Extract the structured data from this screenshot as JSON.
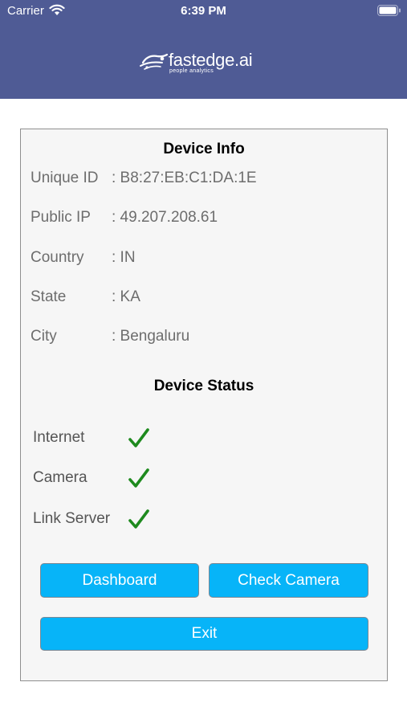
{
  "status_bar": {
    "carrier": "Carrier",
    "time": "6:39 PM"
  },
  "header": {
    "logo_text": "fastedge.ai",
    "logo_tagline": "people analytics"
  },
  "device_info": {
    "title": "Device Info",
    "rows": [
      {
        "label": "Unique ID",
        "value": ": B8:27:EB:C1:DA:1E"
      },
      {
        "label": "Public IP",
        "value": ": 49.207.208.61"
      },
      {
        "label": "Country",
        "value": ": IN"
      },
      {
        "label": "State",
        "value": ": KA"
      },
      {
        "label": "City",
        "value": ": Bengaluru"
      }
    ]
  },
  "device_status": {
    "title": "Device Status",
    "items": [
      {
        "label": "Internet",
        "icon": "checkmark-icon",
        "color": "#1e8a1e"
      },
      {
        "label": "Camera",
        "icon": "checkmark-icon",
        "color": "#1e8a1e"
      },
      {
        "label": "Link Server",
        "icon": "checkmark-icon",
        "color": "#1e8a1e"
      }
    ]
  },
  "buttons": {
    "dashboard": "Dashboard",
    "check_camera": "Check Camera",
    "exit": "Exit"
  },
  "colors": {
    "header": "#4f5b95",
    "button": "#07b4f8",
    "check": "#1e8a1e"
  }
}
